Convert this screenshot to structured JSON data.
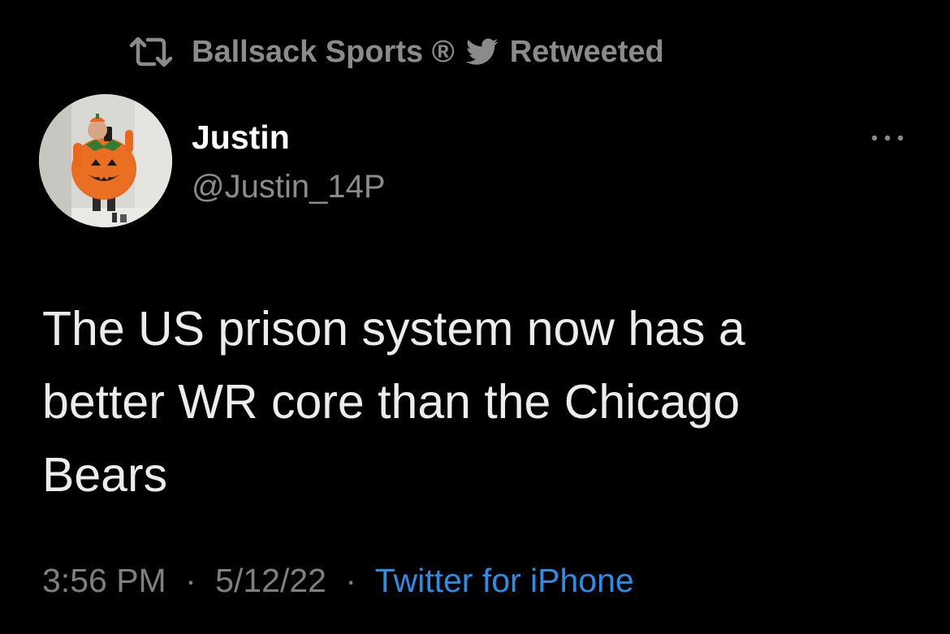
{
  "retweet_bar": {
    "icon": "retweet-icon",
    "retweeter": "Ballsack Sports ®",
    "bird_icon": "twitter-bird-icon",
    "label": "Retweeted"
  },
  "author": {
    "avatar_icon": "avatar",
    "display_name": "Justin",
    "handle": "@Justin_14P"
  },
  "more_icon": "more-options-icon",
  "tweet": {
    "lines": [
      "The US prison system now has a",
      "better WR core than the Chicago",
      "Bears"
    ]
  },
  "meta": {
    "time": "3:56 PM",
    "separator": "·",
    "date": "5/12/22",
    "source": "Twitter for iPhone"
  },
  "colors": {
    "background": "#000000",
    "text_primary": "#ffffff",
    "text_secondary": "#8b8b8b",
    "link": "#2b8ee6",
    "costume_orange": "#e8691e"
  }
}
